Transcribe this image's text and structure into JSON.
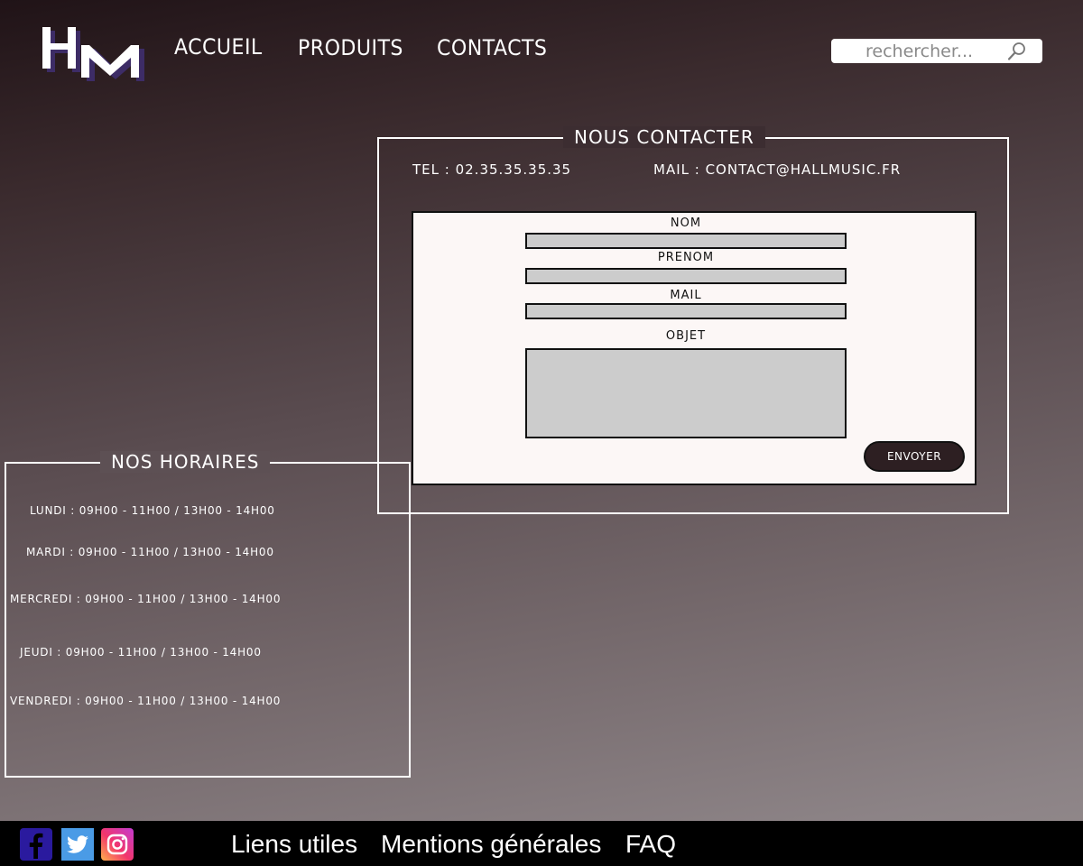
{
  "brand": {
    "logo_text": "HM",
    "accent": "#2d1f22"
  },
  "nav": {
    "items": [
      "ACCUEIL",
      "PRODUITS",
      "CONTACTS"
    ]
  },
  "search": {
    "placeholder": "rechercher...",
    "icon": "search-icon"
  },
  "contact": {
    "title": "NOUS CONTACTER",
    "tel": "TEL : 02.35.35.35.35",
    "mail": "MAIL : CONTACT@HALLMUSIC.FR",
    "form": {
      "nom_label": "NOM",
      "prenom_label": "PRENOM",
      "mail_label": "MAIL",
      "objet_label": "OBJET",
      "submit_label": "ENVOYER"
    }
  },
  "hours": {
    "title": "NOS HORAIRES",
    "rows": [
      "LUNDI : 09H00 - 11H00 / 13H00 - 14H00",
      "MARDI : 09H00 - 11H00 / 13H00 - 14H00",
      "MERCREDI : 09H00 - 11H00 / 13H00 - 14H00",
      "JEUDI : 09H00 - 11H00 / 13H00 - 14H00",
      "VENDREDI : 09H00 - 11H00 / 13H00 - 14H00"
    ]
  },
  "footer": {
    "social": [
      "facebook-icon",
      "twitter-icon",
      "instagram-icon"
    ],
    "links": [
      "Liens utiles",
      "Mentions générales",
      "FAQ"
    ]
  }
}
